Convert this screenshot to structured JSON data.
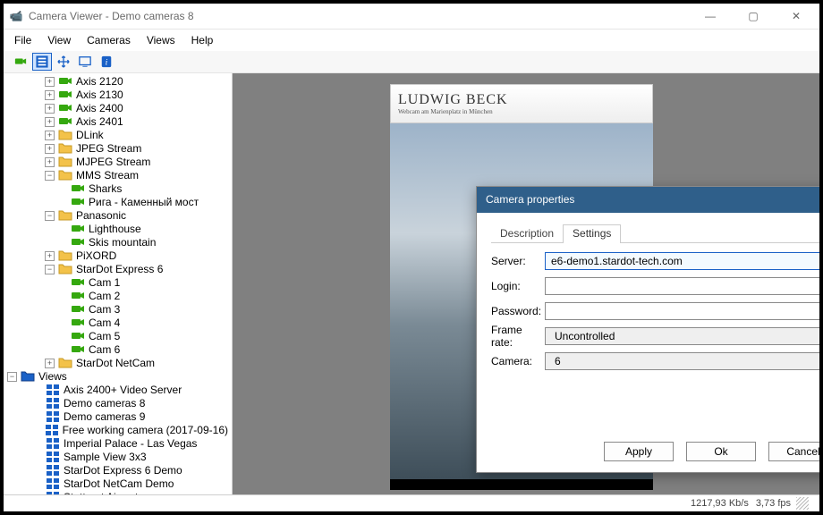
{
  "window": {
    "title": "Camera Viewer - Demo cameras 8"
  },
  "menu": [
    "File",
    "View",
    "Cameras",
    "Views",
    "Help"
  ],
  "toolbar": {
    "items": [
      "camera-icon",
      "list-icon",
      "move-icon",
      "monitor-icon",
      "info-icon"
    ]
  },
  "tree": {
    "camera_items": [
      {
        "label": "Axis 2120",
        "icon": "camera",
        "indent": 3,
        "expander": "+"
      },
      {
        "label": "Axis 2130",
        "icon": "camera",
        "indent": 3,
        "expander": "+"
      },
      {
        "label": "Axis 2400",
        "icon": "camera",
        "indent": 3,
        "expander": "+"
      },
      {
        "label": "Axis 2401",
        "icon": "camera",
        "indent": 3,
        "expander": "+"
      },
      {
        "label": "DLink",
        "icon": "folder",
        "indent": 3,
        "expander": "+"
      },
      {
        "label": "JPEG Stream",
        "icon": "folder",
        "indent": 3,
        "expander": "+"
      },
      {
        "label": "MJPEG Stream",
        "icon": "folder",
        "indent": 3,
        "expander": "+"
      },
      {
        "label": "MMS Stream",
        "icon": "folder",
        "indent": 3,
        "expander": "-"
      },
      {
        "label": "Sharks",
        "icon": "camera",
        "indent": 4,
        "expander": ""
      },
      {
        "label": "Рига - Каменный мост",
        "icon": "camera",
        "indent": 4,
        "expander": ""
      },
      {
        "label": "Panasonic",
        "icon": "folder",
        "indent": 3,
        "expander": "-"
      },
      {
        "label": "Lighthouse",
        "icon": "camera",
        "indent": 4,
        "expander": ""
      },
      {
        "label": "Skis mountain",
        "icon": "camera",
        "indent": 4,
        "expander": ""
      },
      {
        "label": "PiXORD",
        "icon": "folder",
        "indent": 3,
        "expander": "+"
      },
      {
        "label": "StarDot Express 6",
        "icon": "folder",
        "indent": 3,
        "expander": "-"
      },
      {
        "label": "Cam 1",
        "icon": "camera",
        "indent": 4,
        "expander": ""
      },
      {
        "label": "Cam 2",
        "icon": "camera",
        "indent": 4,
        "expander": ""
      },
      {
        "label": "Cam 3",
        "icon": "camera",
        "indent": 4,
        "expander": ""
      },
      {
        "label": "Cam 4",
        "icon": "camera",
        "indent": 4,
        "expander": ""
      },
      {
        "label": "Cam 5",
        "icon": "camera",
        "indent": 4,
        "expander": ""
      },
      {
        "label": "Cam 6",
        "icon": "camera",
        "indent": 4,
        "expander": ""
      },
      {
        "label": "StarDot NetCam",
        "icon": "folder",
        "indent": 3,
        "expander": "+"
      }
    ],
    "views_root": {
      "label": "Views"
    },
    "views": [
      "Axis 2400+ Video Server",
      "Demo cameras 8",
      "Demo cameras 9",
      "Free working camera (2017-09-16)",
      "Imperial Palace - Las Vegas",
      "Sample View 3x3",
      "StarDot Express 6 Demo",
      "StarDot NetCam Demo",
      "Stuttgart Airport"
    ]
  },
  "video": {
    "brand_big": "LUDWIG BECK",
    "brand_small": "Webcam am Marienplatz in München"
  },
  "dialog": {
    "title": "Camera properties",
    "tabs": [
      "Description",
      "Settings"
    ],
    "fields": {
      "server_label": "Server:",
      "server_value": "e6-demo1.stardot-tech.com",
      "login_label": "Login:",
      "login_value": "",
      "password_label": "Password:",
      "password_value": "",
      "framerate_label": "Frame rate:",
      "framerate_value": "Uncontrolled",
      "camera_label": "Camera:",
      "camera_value": "6"
    },
    "buttons": {
      "apply": "Apply",
      "ok": "Ok",
      "cancel": "Cancel"
    }
  },
  "status": {
    "rate": "1217,93 Kb/s",
    "fps": "3,73 fps"
  }
}
